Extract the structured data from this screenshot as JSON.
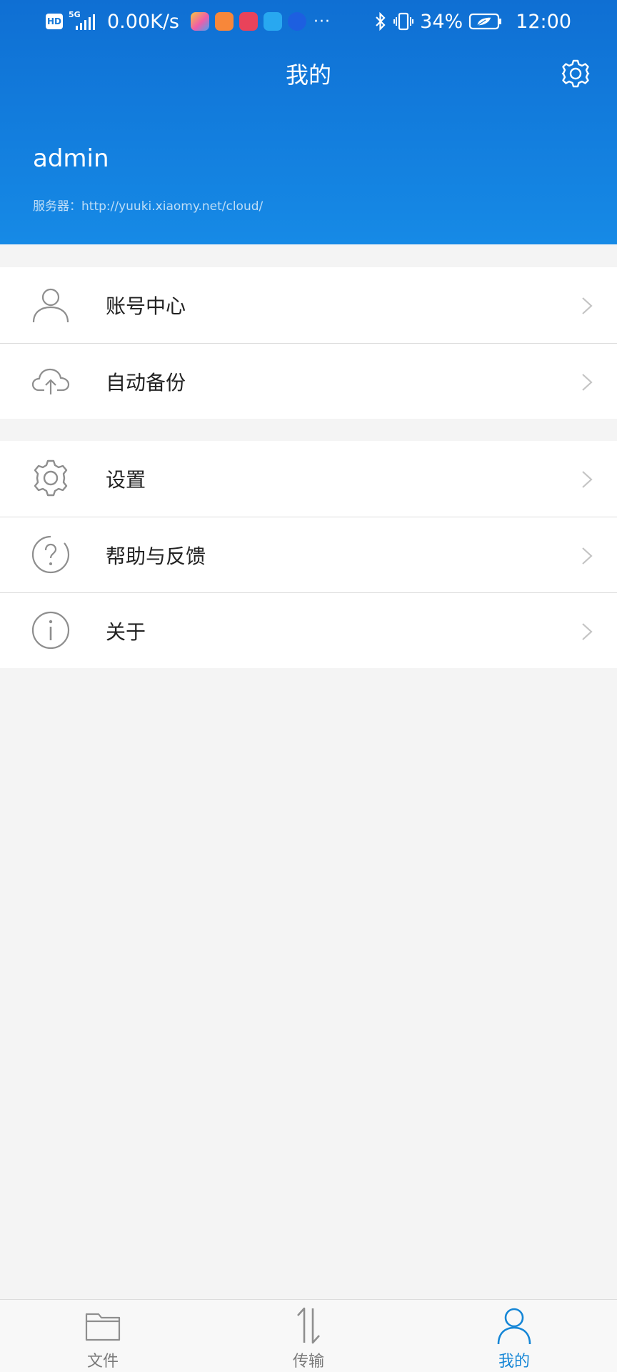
{
  "status_bar": {
    "hd_badge": "HD",
    "network": "5G",
    "speed": "0.00K/s",
    "more": "···",
    "battery_percent": "34%",
    "time": "12:00",
    "icons": [
      "hd-icon",
      "signal-icon",
      "app-icon-1",
      "app-icon-2",
      "app-icon-3",
      "app-icon-4",
      "app-icon-5",
      "bluetooth-icon",
      "vibrate-icon",
      "battery-icon"
    ]
  },
  "header": {
    "title": "我的",
    "username": "admin",
    "server_label": "服务器：http://yuuki.xiaomy.net/cloud/",
    "settings_icon": "gear-icon"
  },
  "menu_groups": [
    {
      "items": [
        {
          "label": "账号中心",
          "icon": "user-icon"
        },
        {
          "label": "自动备份",
          "icon": "cloud-upload-icon"
        }
      ]
    },
    {
      "items": [
        {
          "label": "设置",
          "icon": "gear-icon"
        },
        {
          "label": "帮助与反馈",
          "icon": "help-icon"
        },
        {
          "label": "关于",
          "icon": "info-icon"
        }
      ]
    }
  ],
  "tabs": [
    {
      "label": "文件",
      "icon": "folder-icon",
      "active": false
    },
    {
      "label": "传输",
      "icon": "transfer-icon",
      "active": false
    },
    {
      "label": "我的",
      "icon": "user-icon",
      "active": true
    }
  ],
  "colors": {
    "header_top": "#0f6fd3",
    "header_bottom": "#168ae6",
    "accent": "#1586d6",
    "background": "#f4f4f4",
    "icon_gray": "#8e8e8e"
  }
}
